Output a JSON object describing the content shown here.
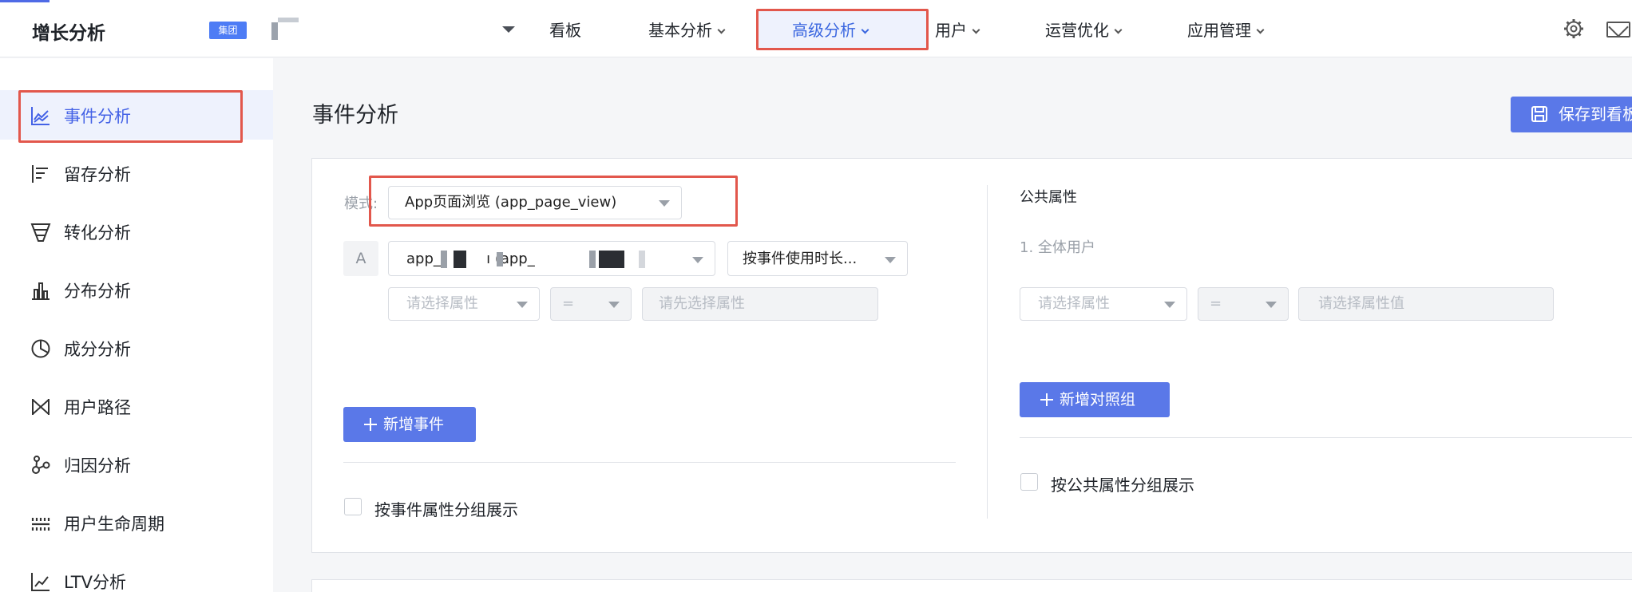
{
  "header": {
    "app_title": "增长分析",
    "group_badge": "集团",
    "nav": {
      "dashboard": "看板",
      "basic": "基本分析",
      "advanced": "高级分析",
      "users": "用户",
      "ops": "运营优化",
      "app_mgmt": "应用管理"
    }
  },
  "sidebar": {
    "items": [
      {
        "label": "事件分析",
        "icon": "line-chart-icon"
      },
      {
        "label": "留存分析",
        "icon": "retention-bars-icon"
      },
      {
        "label": "转化分析",
        "icon": "funnel-icon"
      },
      {
        "label": "分布分析",
        "icon": "bar-chart-icon"
      },
      {
        "label": "成分分析",
        "icon": "pie-chart-icon"
      },
      {
        "label": "用户路径",
        "icon": "path-icon"
      },
      {
        "label": "归因分析",
        "icon": "attribution-icon"
      },
      {
        "label": "用户生命周期",
        "icon": "lifecycle-icon"
      },
      {
        "label": "LTV分析",
        "icon": "trend-icon"
      }
    ]
  },
  "main": {
    "page_title": "事件分析",
    "save_button": "保存到看板",
    "mode_label": "模式:",
    "mode_value": "App页面浏览 (app_page_view)",
    "row_label": "A",
    "event_value": "app_          ı (app_",
    "metric_value": "按事件使用时长...",
    "prop_placeholder": "请选择属性",
    "operator": "=",
    "value_placeholder": "请先选择属性",
    "add_event": "新增事件",
    "group_by_event": "按事件属性分组展示",
    "common_title": "公共属性",
    "all_users": "1. 全体用户",
    "common_prop_placeholder": "请选择属性",
    "common_operator": "=",
    "common_value_placeholder": "请选择属性值",
    "add_control": "新增对照组",
    "group_by_common": "按公共属性分组展示"
  },
  "colors": {
    "accent": "#5a78e8",
    "active_text": "#4462e6",
    "highlight": "#e2574c"
  }
}
